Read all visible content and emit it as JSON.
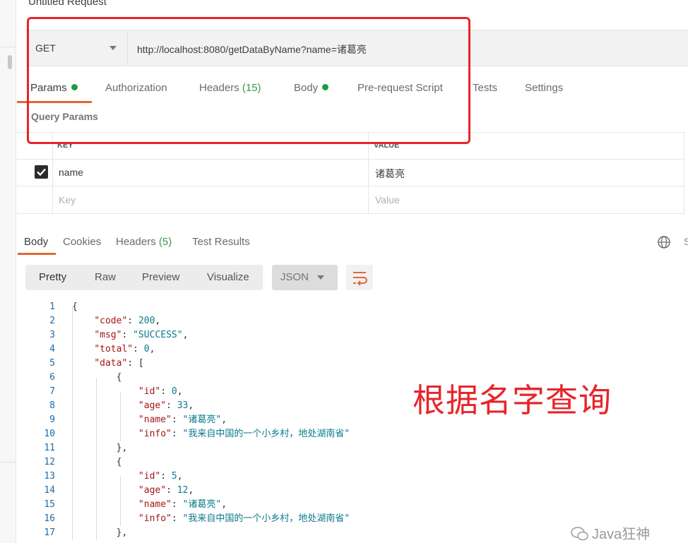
{
  "title": "Untitled Request",
  "request": {
    "method": "GET",
    "url": "http://localhost:8080/getDataByName?name=诸葛亮"
  },
  "tabs": [
    {
      "label": "Params",
      "dot": true,
      "active": true
    },
    {
      "label": "Authorization"
    },
    {
      "label": "Headers",
      "count": "(15)"
    },
    {
      "label": "Body",
      "dot": true
    },
    {
      "label": "Pre-request Script"
    },
    {
      "label": "Tests"
    },
    {
      "label": "Settings"
    }
  ],
  "query_params": {
    "title": "Query Params",
    "columns": [
      "KEY",
      "VALUE"
    ],
    "rows": [
      {
        "checked": true,
        "key": "name",
        "value": "诸葛亮"
      }
    ],
    "key_placeholder": "Key",
    "value_placeholder": "Value"
  },
  "response": {
    "tabs": [
      {
        "label": "Body",
        "active": true
      },
      {
        "label": "Cookies"
      },
      {
        "label": "Headers",
        "count": "(5)"
      },
      {
        "label": "Test Results"
      }
    ],
    "cut_text": "S",
    "formats": [
      "Pretty",
      "Raw",
      "Preview",
      "Visualize"
    ],
    "language": "JSON",
    "lines": [
      {
        "n": "1",
        "text": "{"
      },
      {
        "n": "2",
        "text": "    \"code\": 200,"
      },
      {
        "n": "3",
        "text": "    \"msg\": \"SUCCESS\","
      },
      {
        "n": "4",
        "text": "    \"total\": 0,"
      },
      {
        "n": "5",
        "text": "    \"data\": ["
      },
      {
        "n": "6",
        "text": "        {"
      },
      {
        "n": "7",
        "text": "            \"id\": 0,"
      },
      {
        "n": "8",
        "text": "            \"age\": 33,"
      },
      {
        "n": "9",
        "text": "            \"name\": \"诸葛亮\","
      },
      {
        "n": "10",
        "text": "            \"info\": \"我来自中国的一个小乡村，地处湖南省\""
      },
      {
        "n": "11",
        "text": "        },"
      },
      {
        "n": "12",
        "text": "        {"
      },
      {
        "n": "13",
        "text": "            \"id\": 5,"
      },
      {
        "n": "14",
        "text": "            \"age\": 12,"
      },
      {
        "n": "15",
        "text": "            \"name\": \"诸葛亮\","
      },
      {
        "n": "16",
        "text": "            \"info\": \"我来自中国的一个小乡村，地处湖南省\""
      },
      {
        "n": "17",
        "text": "        },"
      }
    ]
  },
  "annotation": "根据名字查询",
  "watermark": "Java狂神",
  "colors": {
    "accent": "#e06834",
    "annotation_red": "#e8242a",
    "dot_green": "#1f9a45",
    "json_key": "#a31515",
    "json_value": "#0a7a8c"
  }
}
